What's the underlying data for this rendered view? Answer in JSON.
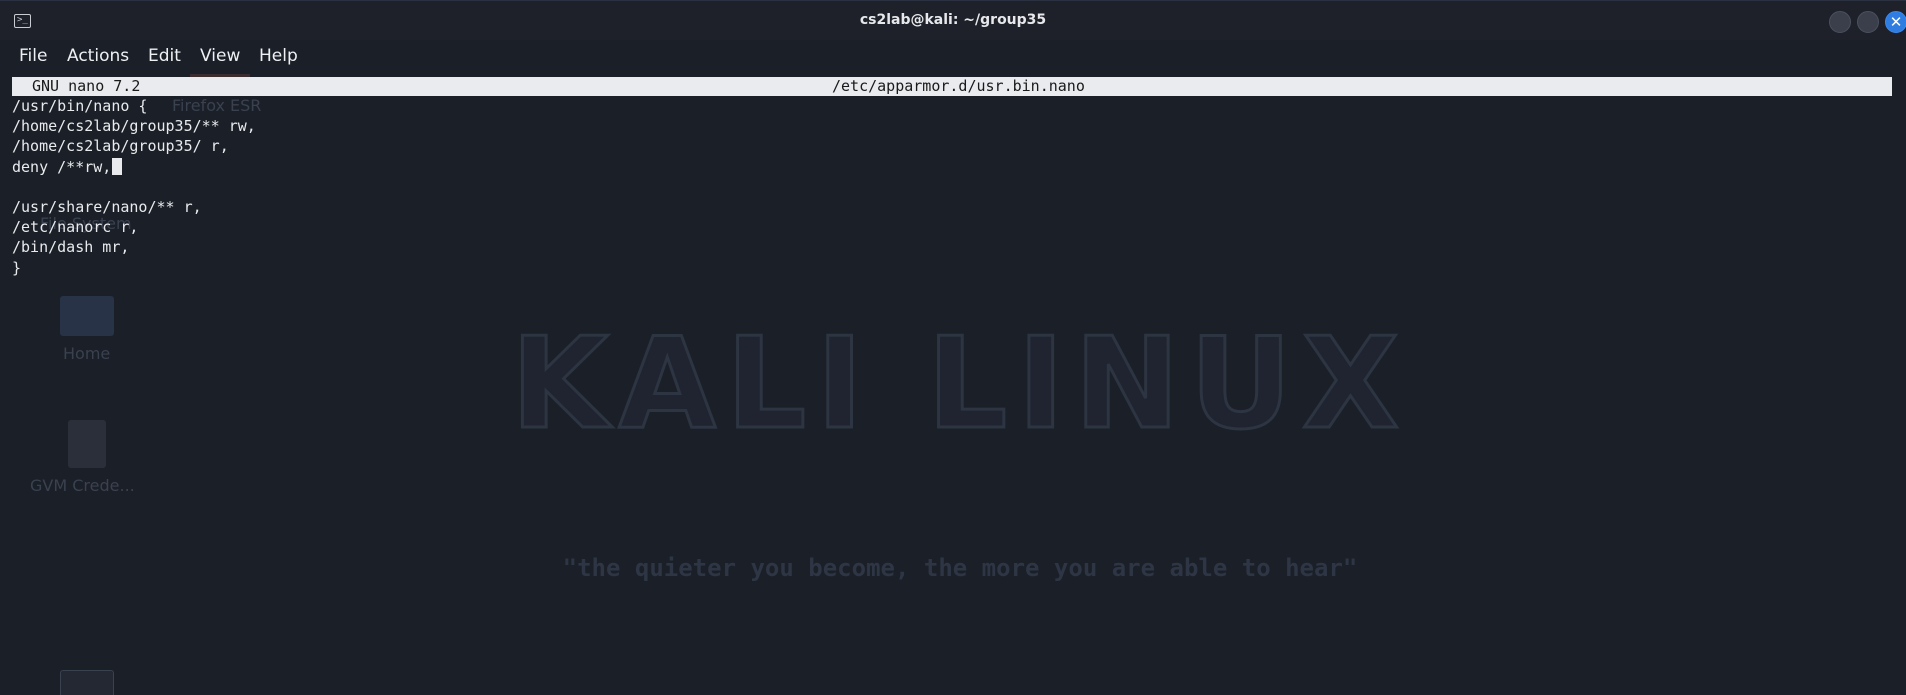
{
  "window": {
    "title": "cs2lab@kali: ~/group35"
  },
  "menu": {
    "items": [
      "File",
      "Actions",
      "Edit",
      "View",
      "Help"
    ]
  },
  "nano": {
    "version": "GNU nano 7.2",
    "filename": "/etc/apparmor.d/usr.bin.nano"
  },
  "editor": {
    "lines": [
      "/usr/bin/nano {",
      "/home/cs2lab/group35/** rw,",
      "/home/cs2lab/group35/ r,",
      "deny /**rw,",
      "",
      "/usr/share/nano/** r,",
      "/etc/nanorc r,",
      "/bin/dash mr,",
      "}"
    ]
  },
  "background": {
    "desktop_labels": [
      "Firefox ESR",
      "File System",
      "Home",
      "GVM Crede..."
    ],
    "wallpaper_title": "KALI LINUX",
    "wallpaper_tagline": "\"the quieter you become, the more you are able to hear\""
  },
  "colors": {
    "accent": "#2f7de1",
    "background": "#1b1f27",
    "nano_header_bg": "#e9ebee"
  }
}
